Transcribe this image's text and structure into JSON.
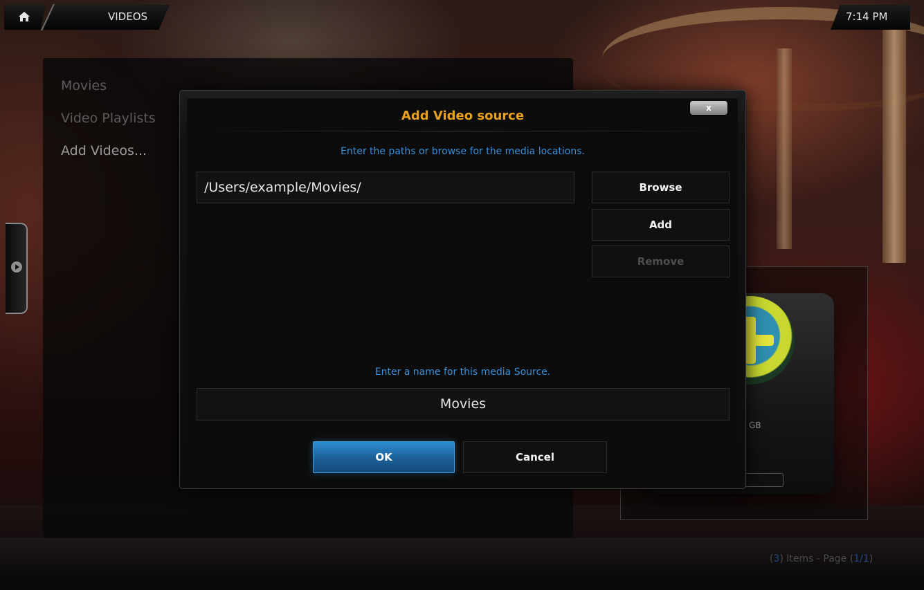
{
  "header": {
    "breadcrumb": "VIDEOS",
    "clock": "7:14 PM"
  },
  "menu": {
    "items": [
      {
        "label": "Movies"
      },
      {
        "label": "Video Playlists"
      },
      {
        "label": "Add Videos..."
      }
    ]
  },
  "dialog": {
    "title": "Add Video source",
    "close_label": "x",
    "paths_hint": "Enter the paths or browse for the media locations.",
    "path_value": "/Users/example/Movies/",
    "browse_label": "Browse",
    "add_label": "Add",
    "remove_label": "Remove",
    "name_hint": "Enter a name for this media Source.",
    "name_value": "Movies",
    "ok_label": "OK",
    "cancel_label": "Cancel"
  },
  "thumb": {
    "drive_label": "GB"
  },
  "footer": {
    "items_open": "(",
    "items_count": "3",
    "items_mid": ") Items - Page (",
    "page": "1/1",
    "items_close": ")"
  },
  "colors": {
    "accent_title": "#e8a11e",
    "hint_blue": "#3a8fd8",
    "ok_blue": "#1b5f97"
  }
}
